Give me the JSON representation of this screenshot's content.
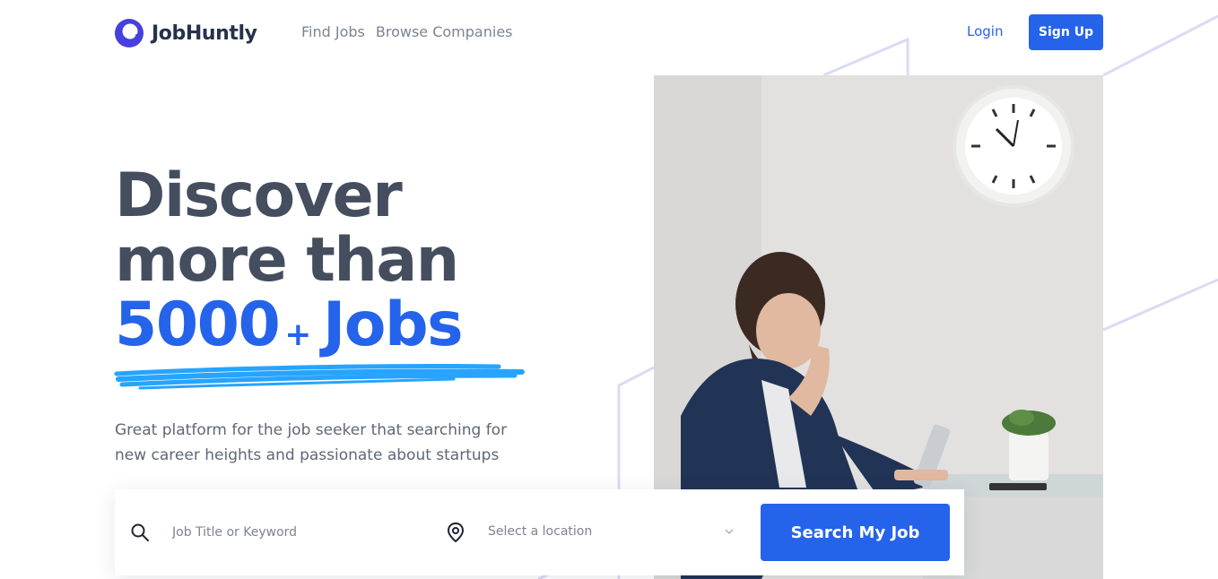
{
  "header": {
    "brand": "JobHuntly",
    "nav": [
      {
        "label": "Find Jobs"
      },
      {
        "label": "Browse Companies"
      }
    ],
    "login_label": "Login",
    "signup_label": "Sign Up"
  },
  "hero": {
    "line1": "Discover",
    "line2": "more than",
    "count": "5000",
    "plus": "+",
    "jobs": "Jobs",
    "subtitle_line1": "Great platform for the job seeker that searching for",
    "subtitle_line2": "new career heights and passionate about startups"
  },
  "search": {
    "keyword_placeholder": "Job Title or Keyword",
    "location_placeholder": "Select a location",
    "button_label": "Search My Job"
  },
  "colors": {
    "primary": "#2563EB",
    "heading": "#444E5F",
    "muted": "#7C8493",
    "underline": "#26A4FF",
    "decor_lines": "#D6DDEB"
  },
  "icons": {
    "logo": "logo-icon",
    "search": "search-icon",
    "location": "location-pin-icon",
    "dropdown": "chevron-down-icon"
  }
}
